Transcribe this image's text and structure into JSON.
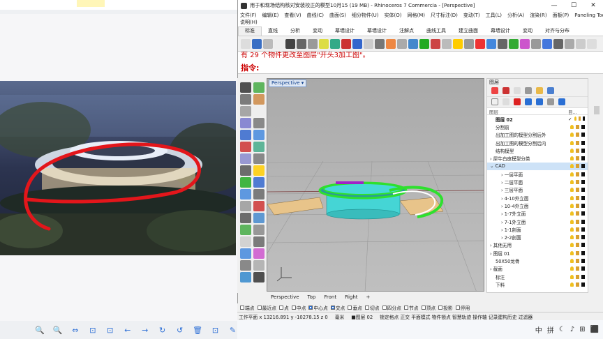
{
  "window": {
    "title": "用于和现场结构核对安装校正的模型10月15 (19 MB) - Rhinoceros 7 Commercia - [Perspective]",
    "controls": [
      "—",
      "☐",
      "✕"
    ]
  },
  "menu": {
    "row1": [
      "文件(F)",
      "编辑(E)",
      "查看(V)",
      "曲线(C)",
      "曲面(S)",
      "细分物件(U)",
      "实体(O)",
      "网格(M)",
      "尺寸标注(D)",
      "变动(T)",
      "工具(L)",
      "分析(A)",
      "渲染(R)",
      "面板(P)",
      "Paneling Tools"
    ],
    "row2": [
      "说明(H)"
    ]
  },
  "toolbar_tabs": [
    "标准",
    "直线",
    "分析",
    "变动",
    "幕墙设计",
    "幕墙设计",
    "注解点",
    "曲线工具",
    "建立曲面",
    "幕墙设计",
    "变动",
    "对齐与分布"
  ],
  "command": {
    "history": "有 29 个物件更改至图层\"开头3加工图\"。",
    "prompt": "指令:"
  },
  "viewport": {
    "label": "Perspective ▾",
    "tabs": [
      "Perspective",
      "Top",
      "Front",
      "Right",
      "+"
    ]
  },
  "layers": {
    "panel_title": "图层",
    "column_header": "图层",
    "column_header2": "目...",
    "rows": [
      {
        "name": "图层 02",
        "indent": 1,
        "bold": true,
        "check": true
      },
      {
        "name": "分割前",
        "indent": 1
      },
      {
        "name": "出加工图的模型分割后外",
        "indent": 1
      },
      {
        "name": "出加工图的模型分割后内",
        "indent": 1
      },
      {
        "name": "结构模型",
        "indent": 1
      },
      {
        "name": "犀牛白皮模型分类",
        "indent": 0,
        "arrow": "›"
      },
      {
        "name": "CAD",
        "indent": 0,
        "arrow": "⌄",
        "selected": true
      },
      {
        "name": "一层平面",
        "indent": 2,
        "arrow": "›"
      },
      {
        "name": "二层平面",
        "indent": 2,
        "arrow": "›"
      },
      {
        "name": "三层平面",
        "indent": 2,
        "arrow": "›"
      },
      {
        "name": "4-10外立面",
        "indent": 2,
        "arrow": "›"
      },
      {
        "name": "10-4外立面",
        "indent": 2,
        "arrow": "›"
      },
      {
        "name": "1-7外立面",
        "indent": 2,
        "arrow": "›"
      },
      {
        "name": "7-1外立面",
        "indent": 2,
        "arrow": "›"
      },
      {
        "name": "1-1剖面",
        "indent": 2,
        "arrow": "›"
      },
      {
        "name": "2-2剖面",
        "indent": 2,
        "arrow": "›"
      },
      {
        "name": "其他无用",
        "indent": 0,
        "arrow": "›"
      },
      {
        "name": "图层 01",
        "indent": 0,
        "arrow": "›"
      },
      {
        "name": "50X50龙骨",
        "indent": 1
      },
      {
        "name": "截面",
        "indent": 0,
        "arrow": "›"
      },
      {
        "name": "标注",
        "indent": 1
      },
      {
        "name": "下料",
        "indent": 1
      }
    ]
  },
  "osnap": [
    "端点",
    "最近点",
    "点",
    "中点",
    "中心点",
    "交点",
    "垂点",
    "切点",
    "四分点",
    "节点",
    "顶点",
    "投影",
    "停用"
  ],
  "osnap_checked": [
    "中心点",
    "交点"
  ],
  "status": {
    "coords": "工作平面 x 13216.891 y -10278.15 z 0",
    "units": "毫米",
    "layer": "■图层 02",
    "modes": "锁定格点 正交 平面模式 物件锁点 智慧轨迹 操作轴 记录建构历史 过滤器"
  },
  "taskbar": {
    "ime": "中",
    "time_icons": [
      "拼",
      "☾",
      "♪",
      "⊞",
      "⬛"
    ]
  },
  "left_viewer": {
    "toolbar": [
      "🔍",
      "🔍",
      "⇔",
      "⊡",
      "⊡",
      "←",
      "→",
      "↻",
      "↺",
      "🗑",
      "⊡",
      "✎"
    ]
  },
  "colors": {
    "accent_blue": "#2d6fd6",
    "command_red": "#cc0000",
    "sketch_red": "#e3161b",
    "ring_green": "#2ee02e",
    "core_cyan": "#45d5d5"
  }
}
